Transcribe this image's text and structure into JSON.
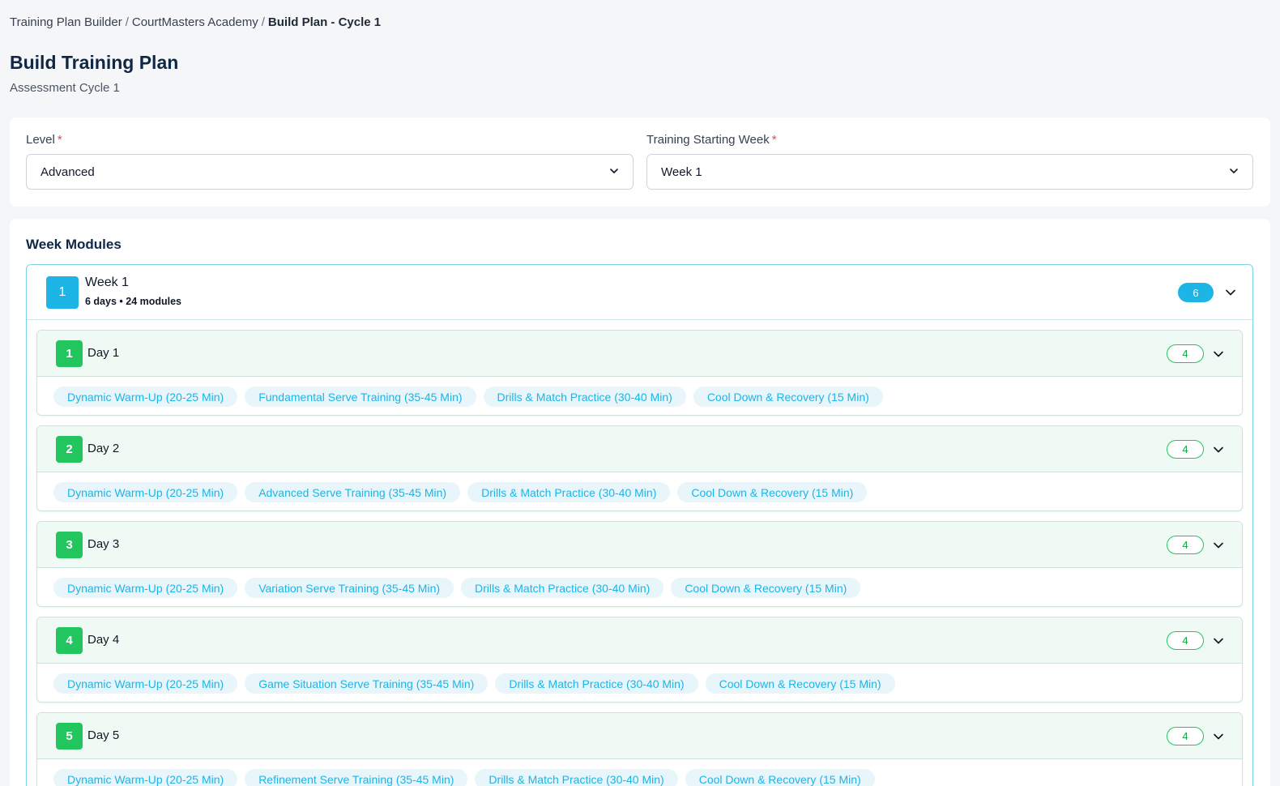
{
  "breadcrumb": {
    "items": [
      "Training Plan Builder",
      "CourtMasters Academy"
    ],
    "current": "Build Plan - Cycle 1",
    "separator": "/"
  },
  "page": {
    "title": "Build Training Plan",
    "subtitle": "Assessment Cycle 1"
  },
  "filters": {
    "level": {
      "label": "Level",
      "required_mark": "*",
      "value": "Advanced"
    },
    "start_week": {
      "label": "Training Starting Week",
      "required_mark": "*",
      "value": "Week 1"
    }
  },
  "week_modules": {
    "title": "Week Modules",
    "week": {
      "number": "1",
      "title": "Week 1",
      "meta": "6 days • 24 modules",
      "count": "6",
      "days": [
        {
          "number": "1",
          "title": "Day 1",
          "count": "4",
          "modules": [
            "Dynamic Warm-Up (20-25 Min)",
            "Fundamental Serve Training (35-45 Min)",
            "Drills & Match Practice (30-40 Min)",
            "Cool Down & Recovery (15 Min)"
          ]
        },
        {
          "number": "2",
          "title": "Day 2",
          "count": "4",
          "modules": [
            "Dynamic Warm-Up (20-25 Min)",
            "Advanced Serve Training (35-45 Min)",
            "Drills & Match Practice (30-40 Min)",
            "Cool Down & Recovery (15 Min)"
          ]
        },
        {
          "number": "3",
          "title": "Day 3",
          "count": "4",
          "modules": [
            "Dynamic Warm-Up (20-25 Min)",
            "Variation Serve Training (35-45 Min)",
            "Drills & Match Practice (30-40 Min)",
            "Cool Down & Recovery (15 Min)"
          ]
        },
        {
          "number": "4",
          "title": "Day 4",
          "count": "4",
          "modules": [
            "Dynamic Warm-Up (20-25 Min)",
            "Game Situation Serve Training (35-45 Min)",
            "Drills & Match Practice (30-40 Min)",
            "Cool Down & Recovery (15 Min)"
          ]
        },
        {
          "number": "5",
          "title": "Day 5",
          "count": "4",
          "modules": [
            "Dynamic Warm-Up (20-25 Min)",
            "Refinement Serve Training (35-45 Min)",
            "Drills & Match Practice (30-40 Min)",
            "Cool Down & Recovery (15 Min)"
          ]
        }
      ]
    }
  },
  "colors": {
    "accent_blue": "#1cb5e5",
    "accent_green": "#22c55e",
    "title_navy": "#0f2744",
    "required_red": "#ef4444"
  },
  "icons": {
    "dropdown": "chevron-down-icon"
  }
}
